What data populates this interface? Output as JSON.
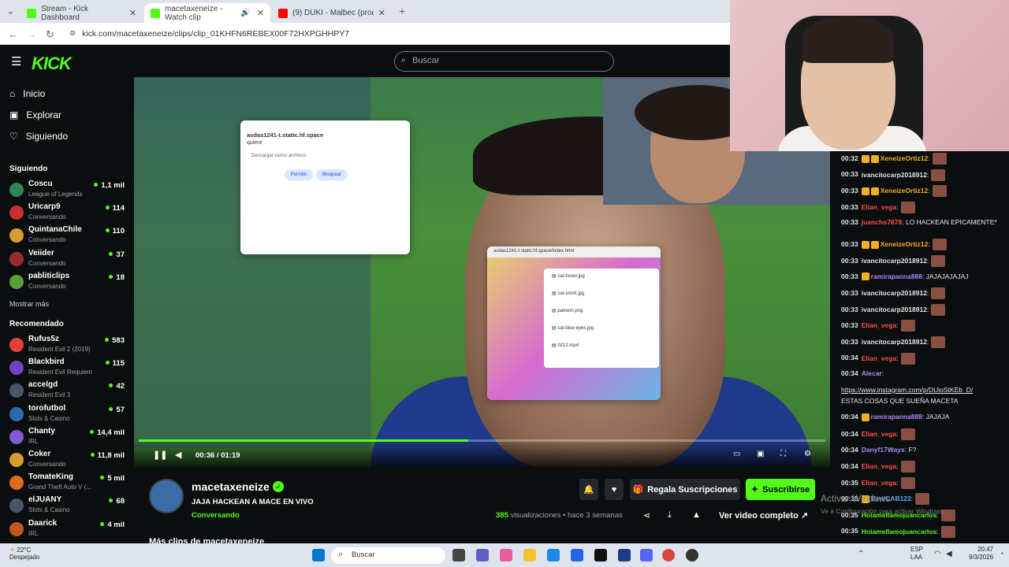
{
  "tabs": [
    {
      "title": "Stream - Kick Dashboard",
      "color": "#53fc18"
    },
    {
      "title": "macetaxeneize - Watch clip",
      "color": "#53fc18"
    },
    {
      "title": "(9) DUKI - Malbec (prod. Bizarr",
      "color": "#ff0000"
    }
  ],
  "address": {
    "url": "kick.com/macetaxeneize/clips/clip_01KHFN6REBEX00F72HXPGHHPY7"
  },
  "header": {
    "logo": "KICK",
    "search_placeholder": "Buscar"
  },
  "nav": [
    {
      "label": "Inicio",
      "icon": "home-icon"
    },
    {
      "label": "Explorar",
      "icon": "compass-icon"
    },
    {
      "label": "Siguiendo",
      "icon": "heart-icon"
    }
  ],
  "following_title": "Siguiendo",
  "following": [
    {
      "name": "Coscu",
      "category": "League of Legends",
      "viewers": "1,1 mil"
    },
    {
      "name": "Uricarp9",
      "category": "Conversando",
      "viewers": "114"
    },
    {
      "name": "QuintanaChile",
      "category": "Conversando",
      "viewers": "110"
    },
    {
      "name": "Veiider",
      "category": "Conversando",
      "viewers": "37"
    },
    {
      "name": "pabliticlips",
      "category": "Conversando",
      "viewers": "18"
    }
  ],
  "show_more": "Mostrar más",
  "recommended_title": "Recomendado",
  "recommended": [
    {
      "name": "Rufus5z",
      "category": "Resident Evil 2 (2019)",
      "viewers": "583"
    },
    {
      "name": "Blackbird",
      "category": "Resident Evil Requiem",
      "viewers": "115"
    },
    {
      "name": "accelgd",
      "category": "Resident Evil 3",
      "viewers": "42"
    },
    {
      "name": "torofutbol",
      "category": "Slots & Casino",
      "viewers": "57"
    },
    {
      "name": "Chanty",
      "category": "IRL",
      "viewers": "14,4 mil"
    },
    {
      "name": "Coker",
      "category": "Conversando",
      "viewers": "11,8 mil"
    },
    {
      "name": "TomateKing",
      "category": "Grand Theft Auto V (...",
      "viewers": "5 mil"
    },
    {
      "name": "elJUANY",
      "category": "Slots & Casino",
      "viewers": "68"
    },
    {
      "name": "Daarick",
      "category": "IRL",
      "viewers": "4 mil"
    }
  ],
  "player": {
    "time": "00:36 / 01:19",
    "progress": 0.48
  },
  "popup1": {
    "site": "asdas1241-t.static.hf.space",
    "wants": "quiere",
    "action": "Descargar varios archivos",
    "allow": "Permitir",
    "block": "Bloquear"
  },
  "popup2": {
    "title": "asdas1241-t.static.hf.space/index.html",
    "files": [
      "cat-hover.jpg",
      "cat-smirk.jpg",
      "patreon.png",
      "cat-blue-eyes.jpg",
      "0212.mp4"
    ]
  },
  "clip": {
    "channel": "macetaxeneize",
    "title": "JAJA HACKEAN A MACE EN VIVO",
    "category": "Conversando",
    "views_count": "385",
    "views_label": "visualizaciones",
    "ago": "• hace 3 semanas",
    "gift_label": "Regala Suscripciones",
    "subscribe_label": "Suscribirse",
    "full_video_label": "Ver video completo",
    "more_clips": "Más clips de macetaxeneize"
  },
  "chat": [
    {
      "ts": "00:32",
      "user": "XeneizeOrtiz12",
      "color": "#f2b01e",
      "text": ":",
      "badges": 2,
      "emote": true
    },
    {
      "ts": "00:33",
      "user": "ivancitocarp2018912",
      "color": "#e5e7eb",
      "text": ":",
      "emote": true
    },
    {
      "ts": "00:33",
      "user": "XeneizeOrtiz12",
      "color": "#f2b01e",
      "text": ":",
      "badges": 2,
      "emote": true
    },
    {
      "ts": "00:33",
      "user": "Elian_vega",
      "color": "#ff4d4d",
      "text": ":",
      "emote": true
    },
    {
      "ts": "00:33",
      "user": "juancho7878",
      "color": "#ff4d4d",
      "text": ": LO HACKEAN EPICAMENTE*"
    },
    {
      "ts": "00:33",
      "user": "XeneizeOrtiz12",
      "color": "#f2b01e",
      "text": ":",
      "badges": 2,
      "emote": true
    },
    {
      "ts": "00:33",
      "user": "ivancitocarp2018912",
      "color": "#e5e7eb",
      "text": ":",
      "emote": true
    },
    {
      "ts": "00:33",
      "user": "ramirapanna888",
      "color": "#a78bfa",
      "text": ": JAJAJAJAJAJ",
      "badges": 1
    },
    {
      "ts": "00:33",
      "user": "ivancitocarp2018912",
      "color": "#e5e7eb",
      "text": ":",
      "emote": true
    },
    {
      "ts": "00:33",
      "user": "ivancitocarp2018912",
      "color": "#e5e7eb",
      "text": ":",
      "emote": true
    },
    {
      "ts": "00:33",
      "user": "Elian_vega",
      "color": "#ff4d4d",
      "text": ":",
      "emote": true
    },
    {
      "ts": "00:33",
      "user": "ivancitocarp2018912",
      "color": "#e5e7eb",
      "text": ":",
      "emote": true
    },
    {
      "ts": "00:34",
      "user": "Elian_vega",
      "color": "#ff4d4d",
      "text": ":",
      "emote": true
    },
    {
      "ts": "00:34",
      "user": "Alecar",
      "color": "#a78bfa",
      "text": ":"
    },
    {
      "ts": "",
      "user": "",
      "color": "#e5e7eb",
      "text": "https://www.instagram.com/p/DUioStKEb_D/",
      "link": true
    },
    {
      "ts": "",
      "user": "",
      "color": "#e5e7eb",
      "text": "ESTAS COSAS QUE SUEÑA MACETA"
    },
    {
      "ts": "00:34",
      "user": "ramirapanna888",
      "color": "#a78bfa",
      "text": ": JAJAJA",
      "badges": 1
    },
    {
      "ts": "00:34",
      "user": "Elian_vega",
      "color": "#ff4d4d",
      "text": ":",
      "emote": true
    },
    {
      "ts": "00:34",
      "user": "Danyf17Ways",
      "color": "#a78bfa",
      "text": ": F?"
    },
    {
      "ts": "00:34",
      "user": "Elian_vega",
      "color": "#ff4d4d",
      "text": ":",
      "emote": true
    },
    {
      "ts": "00:35",
      "user": "Elian_vega",
      "color": "#ff4d4d",
      "text": ":",
      "emote": true
    },
    {
      "ts": "00:35",
      "user": "BeniCAB122",
      "color": "#60a5fa",
      "text": ":",
      "badges": 1,
      "emote": true
    },
    {
      "ts": "00:35",
      "user": "Holamellamojuancarlos",
      "color": "#53fc18",
      "text": ":",
      "emote": true
    },
    {
      "ts": "00:35",
      "user": "Holamellamojuancarlos",
      "color": "#53fc18",
      "text": ":",
      "emote": true
    }
  ],
  "watermark": {
    "line1": "Activar Windows",
    "line2": "Ve a Configuración para activar Windows."
  },
  "taskbar": {
    "temp": "22°C",
    "weather": "Despejado",
    "search": "Buscar",
    "lang1": "ESP",
    "lang2": "LAA",
    "time": "20:47",
    "date": "9/3/2026"
  }
}
